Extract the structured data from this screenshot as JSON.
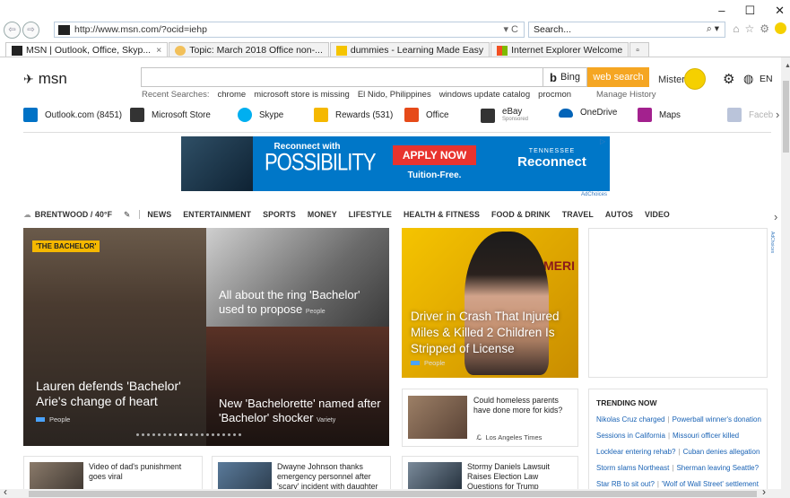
{
  "window": {
    "minimize": "–",
    "maximize": "☐",
    "close": "✕"
  },
  "address": {
    "url": "http://www.msn.com/?ocid=iehp",
    "dropdown": "▾ C"
  },
  "search_box": {
    "placeholder": "Search...",
    "icon": "⌕ ▾"
  },
  "tabs": [
    {
      "label": "MSN | Outlook, Office, Skyp...",
      "close": "×",
      "icon_color": "#222"
    },
    {
      "label": "Topic: March 2018 Office non-...",
      "icon_color": "#f2c05a"
    },
    {
      "label": "dummies - Learning Made Easy",
      "icon_color": "#f5c400"
    },
    {
      "label": "Internet Explorer Welcome",
      "icon_color": "#4a90e2"
    }
  ],
  "msn": {
    "logo": "msn",
    "bing_label": "Bing",
    "web_search_label": "web search",
    "manage_history": "Manage History",
    "recent_label": "Recent Searches:",
    "recent": [
      "chrome",
      "microsoft store is missing",
      "El Nido, Philippines",
      "windows update catalog",
      "procmon"
    ],
    "user_name": "Mister",
    "language": "EN",
    "accent": "#f5a623"
  },
  "quicklinks": [
    {
      "label": "Outlook.com (8451)",
      "color": "#0072c6"
    },
    {
      "label": "Microsoft Store",
      "color": "#333"
    },
    {
      "label": "Skype",
      "color": "#00aff0"
    },
    {
      "label": "Rewards (531)",
      "color": "#f5b800"
    },
    {
      "label": "Office",
      "color": "#e64a19"
    },
    {
      "label": "eBay",
      "sub": "Sponsored",
      "color": "#333"
    },
    {
      "label": "OneDrive",
      "color": "#0364b8"
    },
    {
      "label": "Maps",
      "color": "#a3218e"
    },
    {
      "label": "Faceb",
      "color": "#3b5998"
    }
  ],
  "ad": {
    "small": "Reconnect with",
    "big": "POSSIBILITY",
    "apply": "APPLY NOW",
    "tuition": "Tuition-Free.",
    "tn_small": "TENNESSEE",
    "tn_big": "Reconnect",
    "adchoices": "AdChoices"
  },
  "nav": {
    "weather": "BRENTWOOD / 40°F",
    "items": [
      "NEWS",
      "ENTERTAINMENT",
      "SPORTS",
      "MONEY",
      "LIFESTYLE",
      "HEALTH & FITNESS",
      "FOOD & DRINK",
      "TRAVEL",
      "AUTOS",
      "VIDEO"
    ]
  },
  "cards": {
    "hero1": {
      "badge": "'THE BACHELOR'",
      "title": "Lauren defends 'Bachelor' Arie's change of heart",
      "source": "People"
    },
    "hero2": {
      "title": "All about the ring 'Bachelor' used to propose",
      "source": "People"
    },
    "hero3": {
      "title": "New 'Bachelorette' named after 'Bachelor' shocker",
      "source": "Variety"
    },
    "hero4": {
      "title": "Driver in Crash That Injured Miles & Killed 2 Children Is Stripped of License",
      "source": "People",
      "sign": "AMERI"
    },
    "story": {
      "title": "Could homeless parents have done more for kids?",
      "source": "Los Angeles Times"
    },
    "trending": {
      "heading": "TRENDING NOW",
      "rows": [
        [
          "Nikolas Cruz charged",
          "Powerball winner's donation"
        ],
        [
          "Sessions in California",
          "Missouri officer killed"
        ],
        [
          "Locklear entering rehab?",
          "Cuban denies allegation"
        ],
        [
          "Storm slams Northeast",
          "Sherman leaving Seattle?"
        ],
        [
          "Star RB to sit out?",
          "'Wolf of Wall Street' settlement"
        ]
      ]
    },
    "mini1": {
      "title": "Video of dad's punishment goes viral"
    },
    "mini2": {
      "title": "Dwayne Johnson thanks emergency personnel after 'scary' incident with daughter"
    },
    "mini3": {
      "title": "Stormy Daniels Lawsuit Raises Election Law Questions for Trump"
    }
  }
}
